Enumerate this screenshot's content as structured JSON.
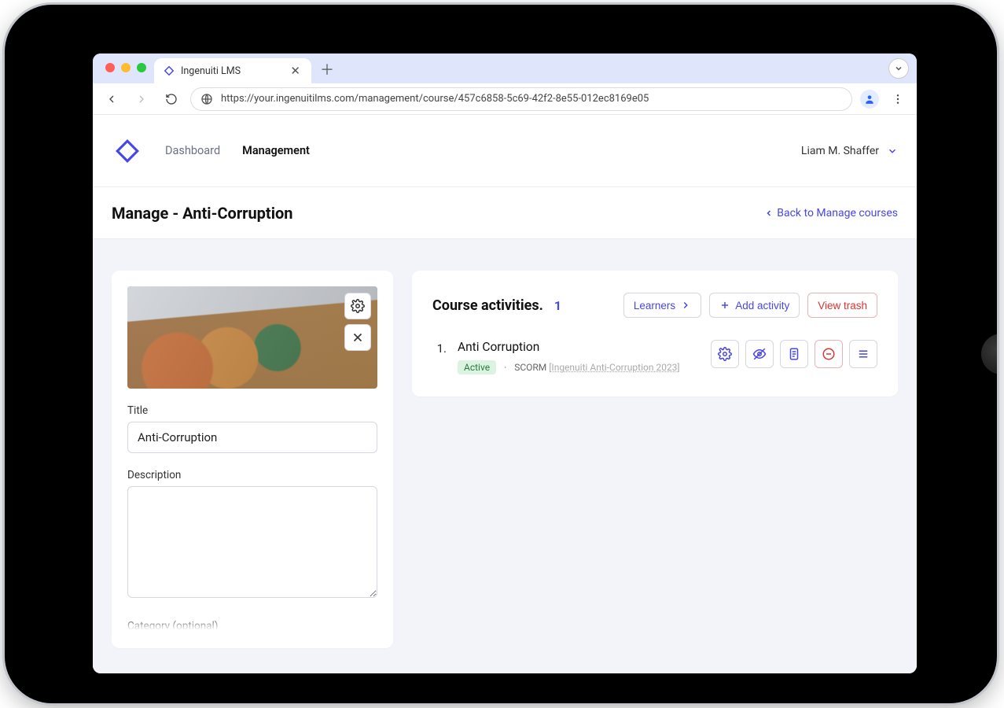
{
  "browser": {
    "tab_title": "Ingenuiti LMS",
    "url": "https://your.ingenuitilms.com/management/course/457c6858-5c69-42f2-8e55-012ec8169e05"
  },
  "nav": {
    "dashboard": "Dashboard",
    "management": "Management"
  },
  "user": {
    "name": "Liam M. Shaffer"
  },
  "subheader": {
    "title": "Manage - Anti-Corruption",
    "back": "Back to Manage courses"
  },
  "course_form": {
    "title_label": "Title",
    "title_value": "Anti-Corruption",
    "description_label": "Description",
    "description_value": "",
    "category_label": "Category (optional)"
  },
  "activities": {
    "heading": "Course activities.",
    "count": "1",
    "learners_btn": "Learners",
    "add_activity_btn": "Add activity",
    "view_trash_btn": "View trash",
    "items": [
      {
        "index": "1.",
        "name": "Anti Corruption",
        "status": "Active",
        "type": "SCORM",
        "package": "[Ingenuiti Anti-Corruption 2023]"
      }
    ]
  }
}
